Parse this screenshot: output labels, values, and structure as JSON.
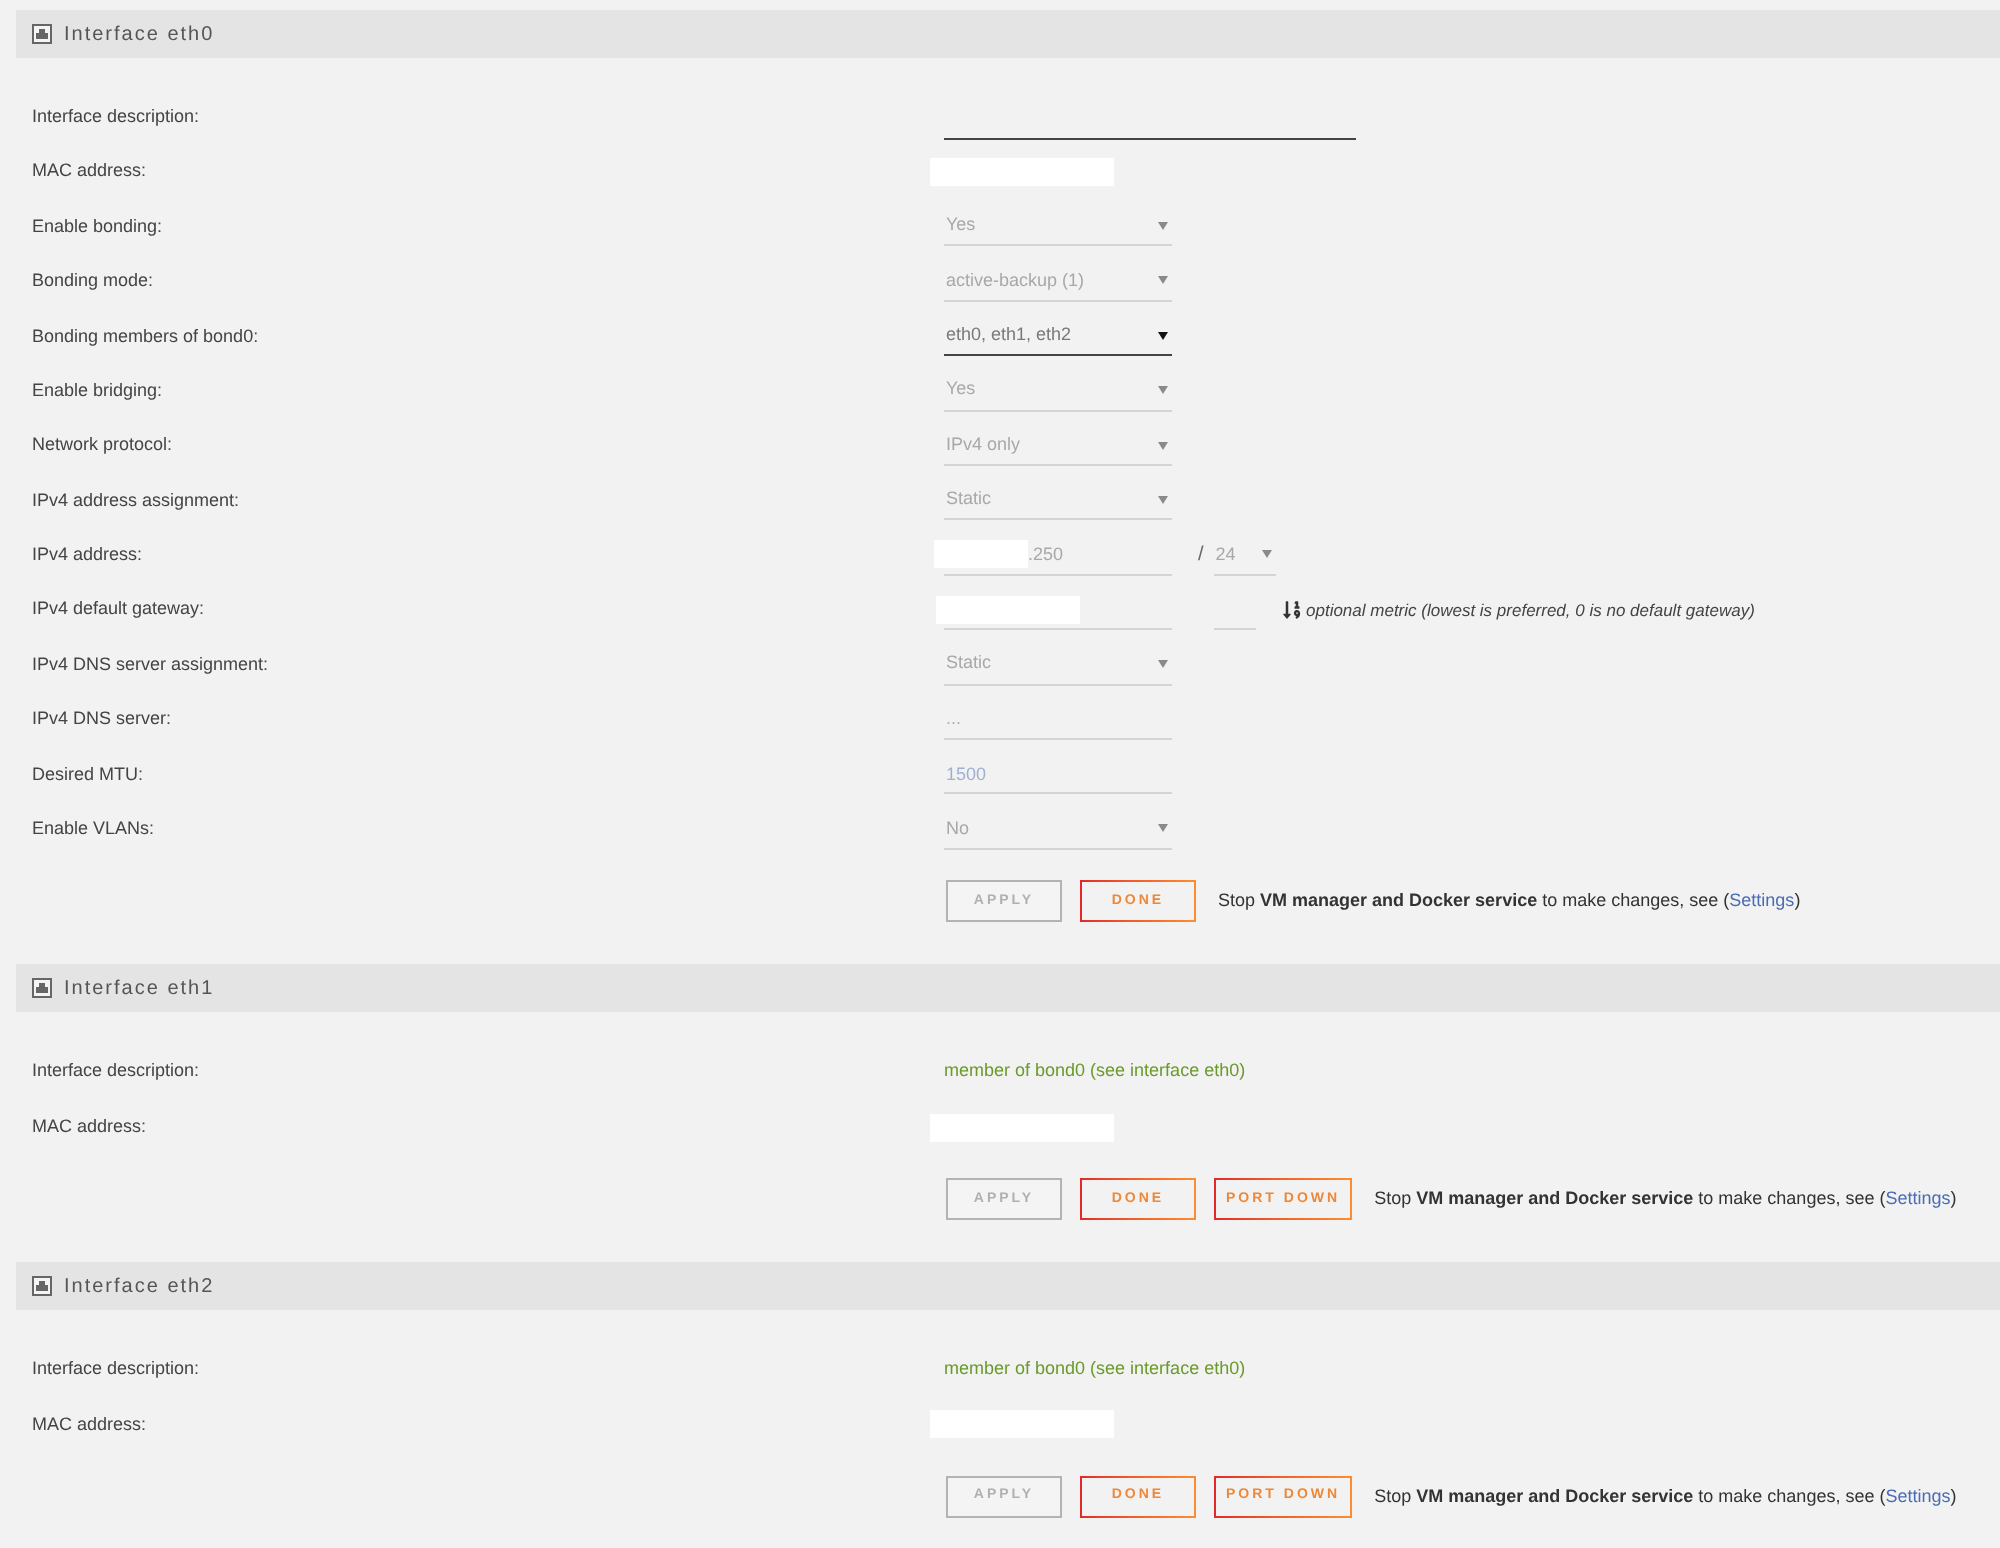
{
  "sections": [
    {
      "title": "Interface eth0",
      "rows": [
        {
          "kind": "text_wide",
          "label": "Interface description:",
          "disabled": false
        },
        {
          "kind": "redacted",
          "label": "MAC address:"
        },
        {
          "kind": "select",
          "label": "Enable bonding:",
          "value": "Yes",
          "disabled": true
        },
        {
          "kind": "select",
          "label": "Bonding mode:",
          "value": "active-backup (1)",
          "disabled": true
        },
        {
          "kind": "select",
          "label": "Bonding members of bond0:",
          "value": "eth0, eth1, eth2",
          "disabled": false
        },
        {
          "kind": "select",
          "label": "Enable bridging:",
          "value": "Yes",
          "disabled": true
        },
        {
          "kind": "select",
          "label": "Network protocol:",
          "value": "IPv4 only",
          "disabled": true
        },
        {
          "kind": "select",
          "label": "IPv4 address assignment:",
          "value": "Static",
          "disabled": true
        },
        {
          "kind": "address",
          "label": "IPv4 address:",
          "value": ".250",
          "disabled": true,
          "separator": "/",
          "netmask": {
            "value": "24",
            "disabled": true
          }
        },
        {
          "kind": "gateway",
          "label": "IPv4 default gateway:",
          "disabled": true,
          "note": "optional metric (lowest is preferred, 0 is no default gateway)"
        },
        {
          "kind": "select",
          "label": "IPv4 DNS server assignment:",
          "value": "Static",
          "disabled": true
        },
        {
          "kind": "text",
          "label": "IPv4 DNS server:",
          "placeholder": "...",
          "disabled": true
        },
        {
          "kind": "text",
          "label": "Desired MTU:",
          "value": "1500",
          "disabled": true
        },
        {
          "kind": "select",
          "label": "Enable VLANs:",
          "value": "No",
          "disabled": true
        }
      ],
      "buttons": [
        {
          "label": "APPLY",
          "disabled": true
        },
        {
          "label": "DONE",
          "disabled": false
        }
      ],
      "notice": {
        "text": "Stop **VM manager and Docker service** to make changes, see (",
        "link": "Settings",
        "end": ")"
      }
    },
    {
      "title": "Interface eth1",
      "rows": [
        {
          "kind": "info",
          "label": "Interface description:",
          "value": "member of bond0 (see interface eth0)"
        },
        {
          "kind": "redacted",
          "label": "MAC address:"
        }
      ],
      "buttons": [
        {
          "label": "APPLY",
          "disabled": true
        },
        {
          "label": "DONE",
          "disabled": false
        },
        {
          "label": "PORT DOWN",
          "disabled": false
        }
      ],
      "notice": {
        "text": "Stop **VM manager and Docker service** to make changes, see (",
        "link": "Settings",
        "end": ")"
      }
    },
    {
      "title": "Interface eth2",
      "rows": [
        {
          "kind": "info",
          "label": "Interface description:",
          "value": "member of bond0 (see interface eth0)"
        },
        {
          "kind": "redacted",
          "label": "MAC address:"
        }
      ],
      "buttons": [
        {
          "label": "APPLY",
          "disabled": true
        },
        {
          "label": "DONE",
          "disabled": false
        },
        {
          "label": "PORT DOWN",
          "disabled": false
        }
      ],
      "notice": {
        "text": "Stop **VM manager and Docker service** to make changes, see (",
        "link": "Settings",
        "end": ")"
      }
    }
  ]
}
